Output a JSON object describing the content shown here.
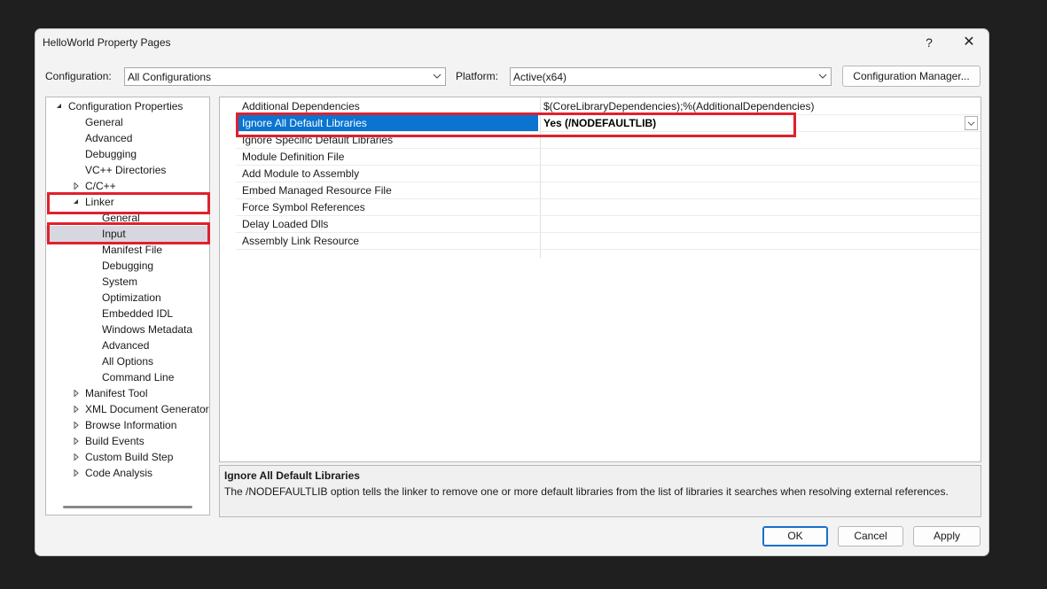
{
  "window": {
    "title": "HelloWorld Property Pages",
    "help_glyph": "?",
    "close_glyph": "✕"
  },
  "toolbar": {
    "configuration_label": "Configuration:",
    "configuration_value": "All Configurations",
    "platform_label": "Platform:",
    "platform_value": "Active(x64)",
    "config_manager_label": "Configuration Manager..."
  },
  "tree": {
    "items": [
      {
        "label": "Configuration Properties",
        "expander": "expanded"
      },
      {
        "label": "General",
        "expander": "none"
      },
      {
        "label": "Advanced",
        "expander": "none"
      },
      {
        "label": "Debugging",
        "expander": "none"
      },
      {
        "label": "VC++ Directories",
        "expander": "none"
      },
      {
        "label": "C/C++",
        "expander": "collapsed"
      },
      {
        "label": "Linker",
        "expander": "expanded"
      },
      {
        "label": "General",
        "expander": "none"
      },
      {
        "label": "Input",
        "expander": "none",
        "selected": true
      },
      {
        "label": "Manifest File",
        "expander": "none"
      },
      {
        "label": "Debugging",
        "expander": "none"
      },
      {
        "label": "System",
        "expander": "none"
      },
      {
        "label": "Optimization",
        "expander": "none"
      },
      {
        "label": "Embedded IDL",
        "expander": "none"
      },
      {
        "label": "Windows Metadata",
        "expander": "none"
      },
      {
        "label": "Advanced",
        "expander": "none"
      },
      {
        "label": "All Options",
        "expander": "none"
      },
      {
        "label": "Command Line",
        "expander": "none"
      },
      {
        "label": "Manifest Tool",
        "expander": "collapsed"
      },
      {
        "label": "XML Document Generator",
        "expander": "collapsed"
      },
      {
        "label": "Browse Information",
        "expander": "collapsed"
      },
      {
        "label": "Build Events",
        "expander": "collapsed"
      },
      {
        "label": "Custom Build Step",
        "expander": "collapsed"
      },
      {
        "label": "Code Analysis",
        "expander": "collapsed"
      }
    ]
  },
  "properties": {
    "rows": [
      {
        "name": "Additional Dependencies",
        "value": "$(CoreLibraryDependencies);%(AdditionalDependencies)"
      },
      {
        "name": "Ignore All Default Libraries",
        "value": "Yes (/NODEFAULTLIB)",
        "selected": true
      },
      {
        "name": "Ignore Specific Default Libraries",
        "value": ""
      },
      {
        "name": "Module Definition File",
        "value": ""
      },
      {
        "name": "Add Module to Assembly",
        "value": ""
      },
      {
        "name": "Embed Managed Resource File",
        "value": ""
      },
      {
        "name": "Force Symbol References",
        "value": ""
      },
      {
        "name": "Delay Loaded Dlls",
        "value": ""
      },
      {
        "name": "Assembly Link Resource",
        "value": ""
      }
    ]
  },
  "description": {
    "title": "Ignore All Default Libraries",
    "text": "The /NODEFAULTLIB option tells the linker to remove one or more default libraries from the list of libraries it searches when resolving external references."
  },
  "buttons": {
    "ok": "OK",
    "cancel": "Cancel",
    "apply": "Apply"
  },
  "colors": {
    "selection_blue": "#0a74d0",
    "highlight_red": "#e0202c",
    "dialog_bg": "#f3f3f3"
  }
}
